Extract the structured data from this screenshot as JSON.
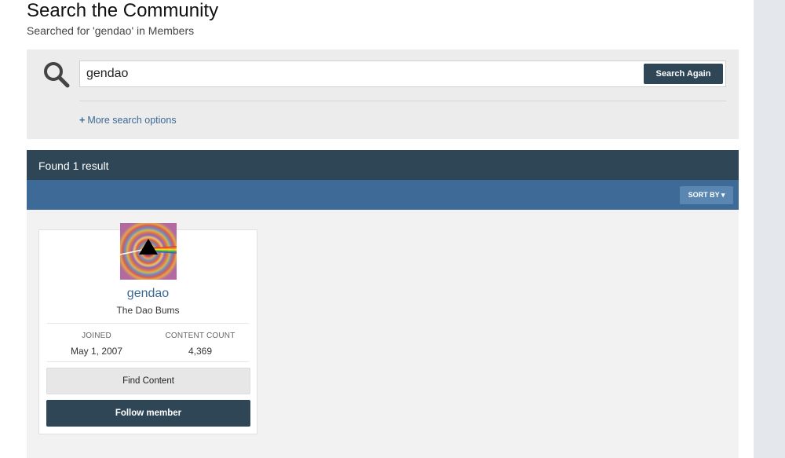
{
  "header": {
    "title": "Search the Community",
    "subtitle": "Searched for 'gendao' in Members"
  },
  "search": {
    "icon": "search-icon",
    "value": "gendao",
    "button_label": "Search Again",
    "more_options_plus": "+",
    "more_options_label": "More search options"
  },
  "results": {
    "count_label": "Found 1 result",
    "sort_label": "SORT BY ▾"
  },
  "member": {
    "avatar_icon": "avatar-prism-image",
    "name": "gendao",
    "group": "The Dao Bums",
    "joined_label": "JOINED",
    "joined_value": "May 1, 2007",
    "content_label": "CONTENT COUNT",
    "content_value": "4,369",
    "find_content_label": "Find Content",
    "follow_label": "Follow member"
  },
  "colors": {
    "accent_dark": "#2f4656",
    "accent_blue": "#3d6a96",
    "link": "#3c6994"
  }
}
